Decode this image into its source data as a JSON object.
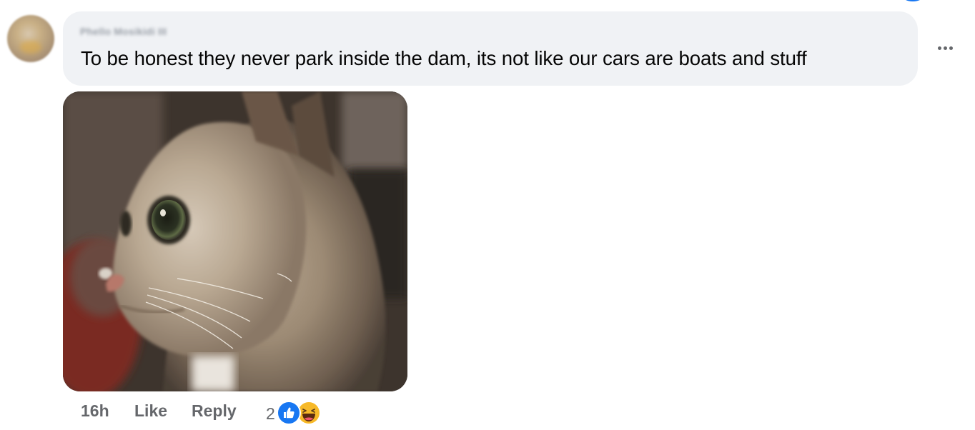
{
  "comment": {
    "author_name": "Phello Mosikidi III",
    "text": "To be honest they never park inside the dam, its not like our cars are boats and stuff",
    "bubble_color": "#f0f2f5"
  },
  "attachment": {
    "type": "image",
    "description_icon": "cat-photo"
  },
  "actions": {
    "timestamp": "16h",
    "like_label": "Like",
    "reply_label": "Reply",
    "more_icon": "more-horizontal-icon"
  },
  "reactions": {
    "count": "2",
    "types": [
      "like",
      "haha"
    ],
    "like_color": "#1877f2",
    "haha_color": "#f7b928"
  },
  "colors": {
    "secondary_text": "#65676b",
    "primary_text": "#050505"
  }
}
